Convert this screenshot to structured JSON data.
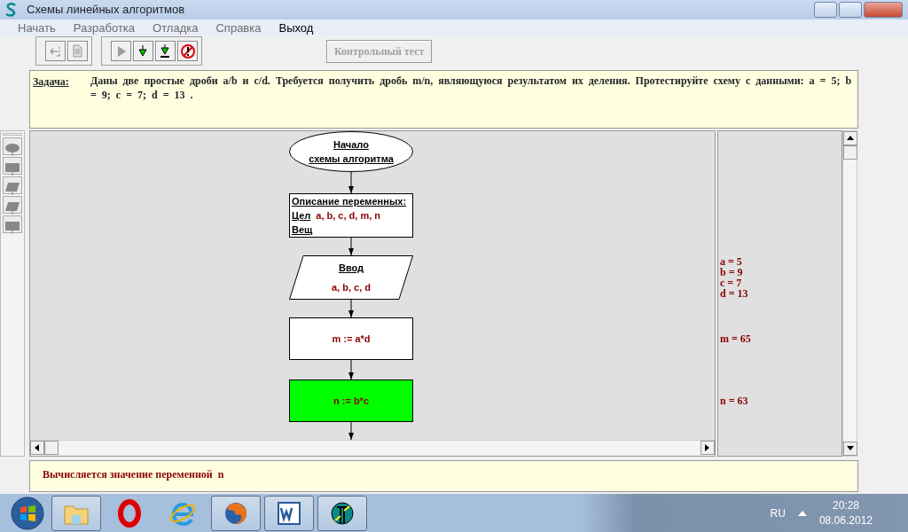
{
  "window": {
    "title": "Схемы линейных алгоритмов"
  },
  "menu": [
    {
      "label": "Начать",
      "disabled": true
    },
    {
      "label": "Разработка",
      "disabled": true
    },
    {
      "label": "Отладка",
      "disabled": true
    },
    {
      "label": "Справка",
      "disabled": true
    },
    {
      "label": "Выход",
      "disabled": false
    }
  ],
  "toolbar_groups": [
    [
      {
        "kind": "back",
        "disabled": true
      },
      {
        "kind": "clear",
        "disabled": true
      }
    ],
    [
      {
        "kind": "run",
        "disabled": true
      },
      {
        "kind": "step",
        "disabled": false
      },
      {
        "kind": "step-over",
        "disabled": false
      },
      {
        "kind": "stop",
        "disabled": false
      }
    ]
  ],
  "test_button": {
    "label": "Контрольный тест",
    "disabled": true
  },
  "task": {
    "label": "Задача:",
    "text": "Даны две простые дроби a/b и c/d. Требуется получить дробь m/n, являющуюся результатом их деления.      Протестируйте схему с данными: a = 5;  b = 9;  c = 7;  d = 13 ."
  },
  "palette": [
    {
      "kind": "terminal"
    },
    {
      "kind": "process"
    },
    {
      "kind": "input"
    },
    {
      "kind": "output"
    },
    {
      "kind": "process"
    }
  ],
  "flowchart": {
    "nodes": [
      {
        "kind": "terminal",
        "active": false,
        "lines": [
          "Начало",
          "схемы алгоритма"
        ]
      },
      {
        "kind": "declaration",
        "active": false,
        "title": "Описание переменных:",
        "rows": [
          {
            "type": "Цел",
            "vars": "a, b, c, d, m, n"
          },
          {
            "type": "Вещ"
          }
        ]
      },
      {
        "kind": "input",
        "active": false,
        "title": "Ввод",
        "text": "a, b, c, d",
        "trace": [
          "a = 5",
          "b = 9",
          "c = 7",
          "d = 13"
        ]
      },
      {
        "kind": "process",
        "active": false,
        "text": "m := a*d",
        "trace": [
          "m = 65"
        ]
      },
      {
        "kind": "process",
        "active": true,
        "text": "n := b*c",
        "trace": [
          "n = 63"
        ]
      }
    ]
  },
  "status": "Вычисляется значение переменной  n",
  "taskbar": {
    "apps": [
      {
        "kind": "folder",
        "running": true
      },
      {
        "kind": "letter-o",
        "running": false
      },
      {
        "kind": "letter-e",
        "running": false
      },
      {
        "kind": "globe",
        "running": true
      },
      {
        "kind": "document",
        "running": true
      },
      {
        "kind": "app",
        "running": true
      }
    ],
    "language": "RU",
    "time": "20:28",
    "date": "08.06.2012"
  }
}
